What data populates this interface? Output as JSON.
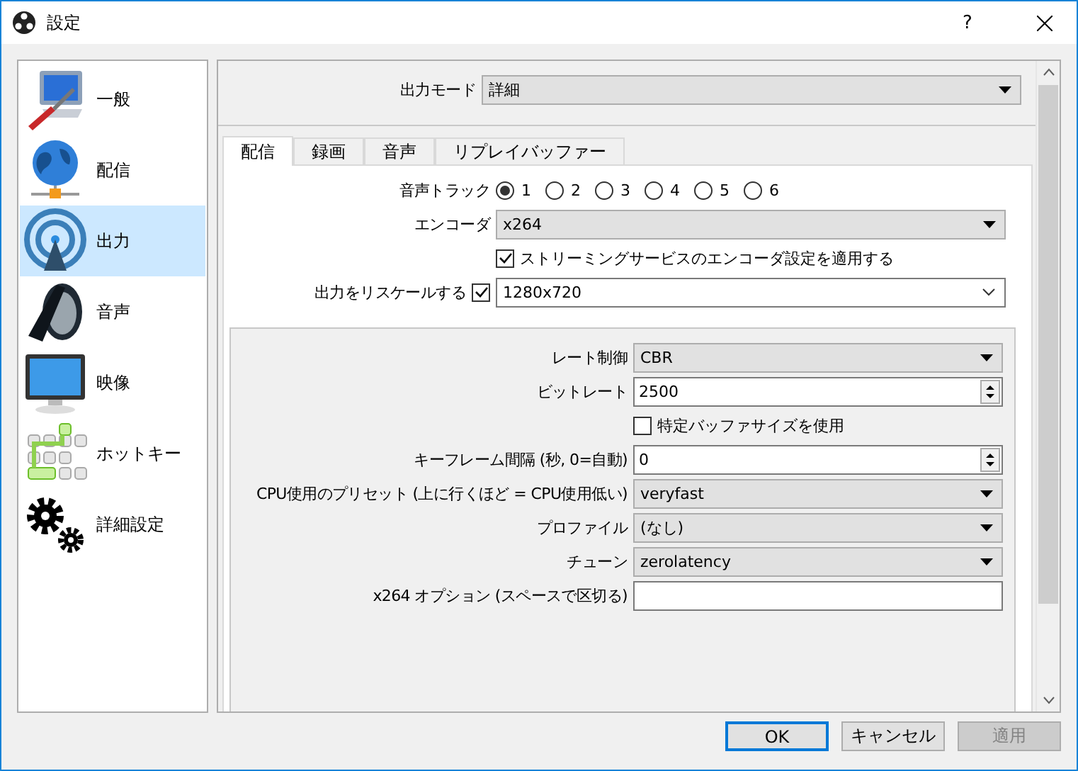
{
  "window": {
    "title": "設定",
    "help": "?"
  },
  "sidebar": {
    "items": [
      {
        "label": "一般",
        "selected": false
      },
      {
        "label": "配信",
        "selected": false
      },
      {
        "label": "出力",
        "selected": true
      },
      {
        "label": "音声",
        "selected": false
      },
      {
        "label": "映像",
        "selected": false
      },
      {
        "label": "ホットキー",
        "selected": false
      },
      {
        "label": "詳細設定",
        "selected": false
      }
    ]
  },
  "output_mode": {
    "label": "出力モード",
    "value": "詳細"
  },
  "tabs": [
    {
      "label": "配信",
      "selected": true
    },
    {
      "label": "録画",
      "selected": false
    },
    {
      "label": "音声",
      "selected": false
    },
    {
      "label": "リプレイバッファー",
      "selected": false
    }
  ],
  "stream": {
    "audio_track": {
      "label": "音声トラック",
      "options": [
        {
          "label": "1",
          "selected": true
        },
        {
          "label": "2",
          "selected": false
        },
        {
          "label": "3",
          "selected": false
        },
        {
          "label": "4",
          "selected": false
        },
        {
          "label": "5",
          "selected": false
        },
        {
          "label": "6",
          "selected": false
        }
      ]
    },
    "encoder": {
      "label": "エンコーダ",
      "value": "x264"
    },
    "apply_service": {
      "label": "ストリーミングサービスのエンコーダ設定を適用する",
      "checked": true
    },
    "rescale": {
      "label": "出力をリスケールする",
      "checked": true,
      "value": "1280x720"
    }
  },
  "encoder_settings": [
    {
      "kind": "select",
      "label": "レート制御",
      "value": "CBR"
    },
    {
      "kind": "spin",
      "label": "ビットレート",
      "value": "2500"
    },
    {
      "kind": "checkbox",
      "label": "特定バッファサイズを使用",
      "checked": false
    },
    {
      "kind": "spin",
      "label": "キーフレーム間隔 (秒, 0=自動)",
      "value": "0"
    },
    {
      "kind": "select",
      "label": "CPU使用のプリセット (上に行くほど = CPU使用低い)",
      "value": "veryfast"
    },
    {
      "kind": "select",
      "label": "プロファイル",
      "value": "(なし)"
    },
    {
      "kind": "select",
      "label": "チューン",
      "value": "zerolatency"
    },
    {
      "kind": "text",
      "label": "x264 オプション (スペースで区切る)"
    }
  ],
  "buttons": [
    {
      "label": "OK",
      "default": true,
      "disabled": false
    },
    {
      "label": "キャンセル",
      "default": false,
      "disabled": false
    },
    {
      "label": "適用",
      "default": false,
      "disabled": true
    }
  ]
}
